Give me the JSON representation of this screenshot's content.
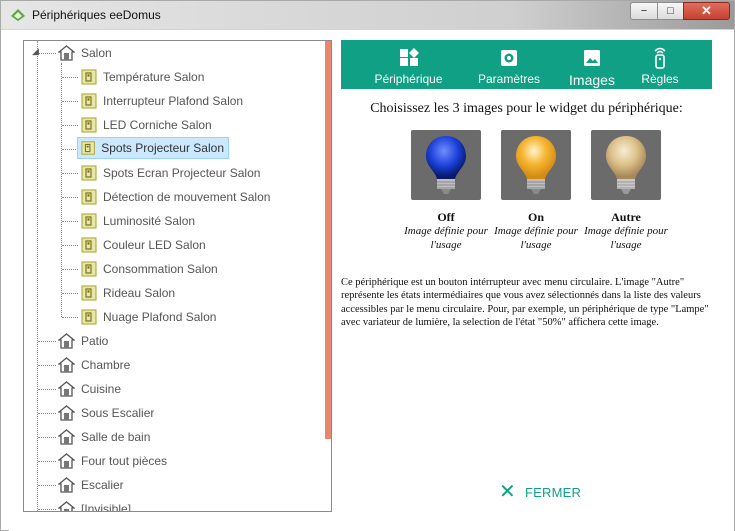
{
  "window": {
    "title": "Périphériques eeDomus",
    "minimize": "−",
    "maximize": "□",
    "close": "✕"
  },
  "tree": {
    "root": {
      "label": "Salon",
      "expanded": true
    },
    "children": [
      {
        "label": "Température Salon"
      },
      {
        "label": "Interrupteur Plafond Salon"
      },
      {
        "label": "LED Corniche Salon"
      },
      {
        "label": "Spots Projecteur Salon",
        "selected": true
      },
      {
        "label": "Spots Ecran Projecteur Salon"
      },
      {
        "label": "Détection de mouvement Salon"
      },
      {
        "label": "Luminosité Salon"
      },
      {
        "label": "Couleur LED Salon"
      },
      {
        "label": "Consommation Salon"
      },
      {
        "label": "Rideau Salon"
      },
      {
        "label": "Nuage Plafond Salon"
      }
    ],
    "rooms": [
      {
        "label": "Patio"
      },
      {
        "label": "Chambre"
      },
      {
        "label": "Cuisine"
      },
      {
        "label": "Sous Escalier"
      },
      {
        "label": "Salle de bain"
      },
      {
        "label": "Four tout pièces"
      },
      {
        "label": "Escalier"
      },
      {
        "label": "[Invisible]"
      }
    ]
  },
  "tabs": [
    {
      "label": "Périphérique",
      "icon": "widgets-icon"
    },
    {
      "label": "Paramètres",
      "icon": "gear-icon"
    },
    {
      "label": "Images",
      "icon": "image-icon",
      "active": true
    },
    {
      "label": "Règles",
      "icon": "remote-icon"
    }
  ],
  "images_section": {
    "heading": "Choisissez les 3 images pour le widget du périphérique:",
    "images": [
      {
        "name": "Off",
        "subtitle": "Image définie pour l'usage",
        "bulb_color": "#1a3fd6"
      },
      {
        "name": "On",
        "subtitle": "Image définie pour l'usage",
        "bulb_color": "#f6b733"
      },
      {
        "name": "Autre",
        "subtitle": "Image définie pour l'usage",
        "bulb_color": "#dcc089"
      }
    ],
    "description": "Ce périphérique est un bouton intérrupteur avec menu circulaire. L'image \"Autre\" représente les états intermédiaires que vous avez sélectionnés dans la liste des valeurs accessibles par le menu circulaire. Pour, par exemple, un périphérique de type \"Lampe\" avec variateur de lumière, la selection de l'état \"50%\" affichera cette image."
  },
  "footer": {
    "close_label": "FERMER"
  },
  "colors": {
    "accent": "#10a085",
    "scroll_strip": "#e8876f",
    "selection": "#cce8ff"
  }
}
